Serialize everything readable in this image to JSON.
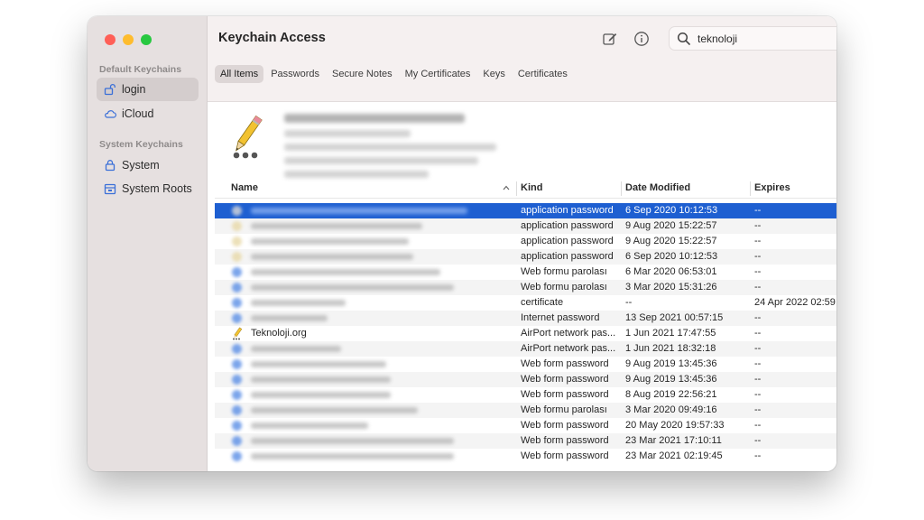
{
  "window": {
    "title": "Keychain Access"
  },
  "search": {
    "value": "teknoloji"
  },
  "sidebar": {
    "sections": [
      {
        "title": "Default Keychains",
        "items": [
          {
            "label": "login",
            "icon": "lock-open-icon",
            "selected": true
          },
          {
            "label": "iCloud",
            "icon": "cloud-icon",
            "selected": false
          }
        ]
      },
      {
        "title": "System Keychains",
        "items": [
          {
            "label": "System",
            "icon": "lock-icon",
            "selected": false
          },
          {
            "label": "System Roots",
            "icon": "cabinet-icon",
            "selected": false
          }
        ]
      }
    ]
  },
  "tabs": [
    "All Items",
    "Passwords",
    "Secure Notes",
    "My Certificates",
    "Keys",
    "Certificates"
  ],
  "active_tab": "All Items",
  "table": {
    "columns": {
      "name": "Name",
      "kind": "Kind",
      "date": "Date Modified",
      "expires": "Expires"
    },
    "rows": [
      {
        "name": "",
        "kind": "application password",
        "date": "6 Sep 2020 10:12:53",
        "expires": "--"
      },
      {
        "name": "",
        "kind": "application password",
        "date": "9 Aug 2020 15:22:57",
        "expires": "--"
      },
      {
        "name": "",
        "kind": "application password",
        "date": "9 Aug 2020 15:22:57",
        "expires": "--"
      },
      {
        "name": "",
        "kind": "application password",
        "date": "6 Sep 2020 10:12:53",
        "expires": "--"
      },
      {
        "name": "",
        "kind": "Web formu parolası",
        "date": "6 Mar 2020 06:53:01",
        "expires": "--"
      },
      {
        "name": "",
        "kind": "Web formu parolası",
        "date": "3 Mar 2020 15:31:26",
        "expires": "--"
      },
      {
        "name": "",
        "kind": "certificate",
        "date": "--",
        "expires": "24 Apr 2022 02:59"
      },
      {
        "name": "",
        "kind": "Internet password",
        "date": "13 Sep 2021 00:57:15",
        "expires": "--"
      },
      {
        "name": "Teknoloji.org",
        "kind": "AirPort network pas...",
        "date": "1 Jun 2021 17:47:55",
        "expires": "--"
      },
      {
        "name": "",
        "kind": "AirPort network pas...",
        "date": "1 Jun 2021 18:32:18",
        "expires": "--"
      },
      {
        "name": "",
        "kind": "Web form password",
        "date": "9 Aug 2019 13:45:36",
        "expires": "--"
      },
      {
        "name": "",
        "kind": "Web form password",
        "date": "9 Aug 2019 13:45:36",
        "expires": "--"
      },
      {
        "name": "",
        "kind": "Web form password",
        "date": "8 Aug 2019 22:56:21",
        "expires": "--"
      },
      {
        "name": "",
        "kind": "Web formu parolası",
        "date": "3 Mar 2020 09:49:16",
        "expires": "--"
      },
      {
        "name": "",
        "kind": "Web form password",
        "date": "20 May 2020 19:57:33",
        "expires": "--"
      },
      {
        "name": "",
        "kind": "Web form password",
        "date": "23 Mar 2021 17:10:11",
        "expires": "--"
      },
      {
        "name": "",
        "kind": "Web form password",
        "date": "23 Mar 2021 02:19:45",
        "expires": "--"
      }
    ]
  },
  "colors": {
    "selection": "#1e5fd1",
    "sidebar": "#e6e0e0"
  }
}
